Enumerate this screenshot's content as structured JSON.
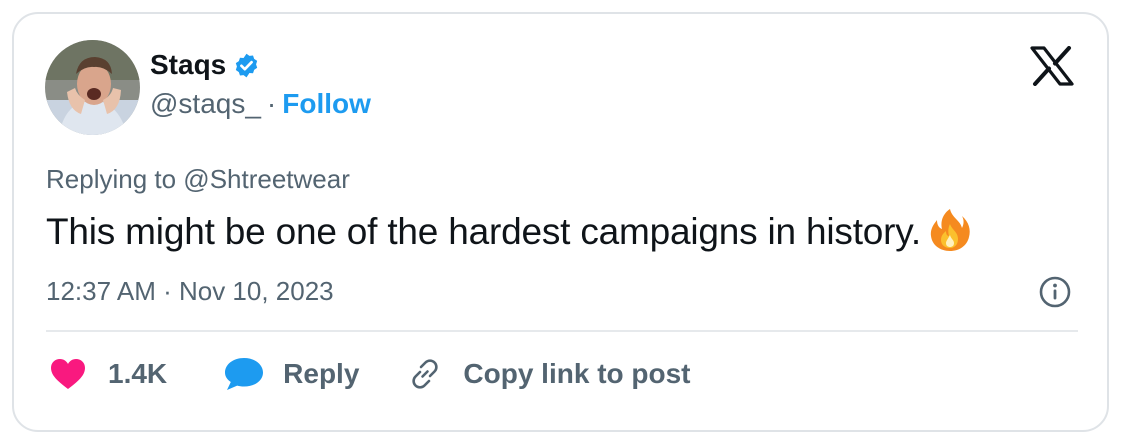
{
  "author": {
    "name": "Staqs",
    "handle": "@staqs_",
    "separator": "·",
    "follow_label": "Follow"
  },
  "tweet": {
    "replying_to": "Replying to @Shtreetwear",
    "text": "This might be one of the hardest campaigns in history.",
    "emoji": "fire-emoji",
    "timestamp": "12:37 AM · Nov 10, 2023"
  },
  "actions": {
    "like_count": "1.4K",
    "reply_label": "Reply",
    "copy_label": "Copy link to post"
  },
  "colors": {
    "accent": "#1d9bf0",
    "like": "#f9197f",
    "text": "#0f1419",
    "secondary": "#536471"
  }
}
